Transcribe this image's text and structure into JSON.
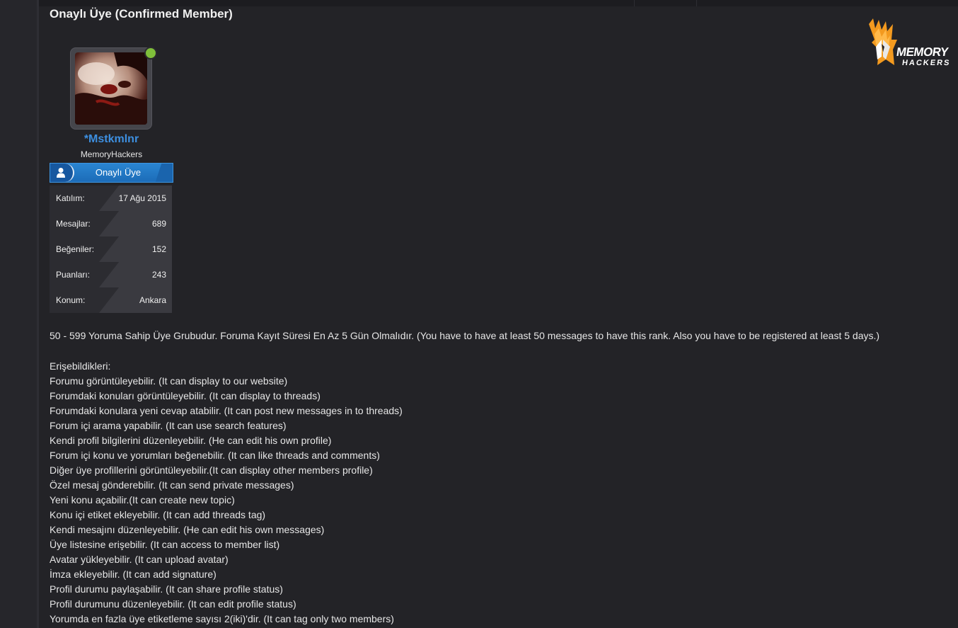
{
  "page": {
    "title": "Onaylı Üye (Confirmed Member)"
  },
  "logo": {
    "line1": "MEMORY",
    "line2": "HACKERS",
    "accent_color": "#f39a1f"
  },
  "profile": {
    "username": "*Mstkmlnr",
    "user_title": "MemoryHackers",
    "online": true,
    "rank_label": "Onaylı Üye",
    "rank_icon": "user-icon",
    "stats": [
      {
        "label": "Katılım:",
        "value": "17 Ağu 2015"
      },
      {
        "label": "Mesajlar:",
        "value": "689"
      },
      {
        "label": "Beğeniler:",
        "value": "152"
      },
      {
        "label": "Puanları:",
        "value": "243"
      },
      {
        "label": "Konum:",
        "value": "Ankara"
      }
    ]
  },
  "description": "50 - 599 Yoruma Sahip Üye Grubudur. Foruma Kayıt Süresi En Az 5 Gün Olmalıdır. (You have to have at least 50 messages to have this rank. Also you have to be registered at least 5 days.)",
  "permissions": {
    "heading": "Erişebildikleri:",
    "items": [
      "Forumu görüntüleyebilir. (It can display to our website)",
      "Forumdaki konuları görüntüleyebilir. (It can display to threads)",
      "Forumdaki konulara yeni cevap atabilir. (It can post new messages in to threads)",
      "Forum içi arama yapabilir. (It can use search features)",
      "Kendi profil bilgilerini düzenleyebilir. (He can edit his own profile)",
      "Forum içi konu ve yorumları beğenebilir. (It can like threads and comments)",
      "Diğer üye profillerini görüntüleyebilir.(It can display other members profile)",
      "Özel mesaj gönderebilir. (It can send private messages)",
      "Yeni konu açabilir.(It can create new topic)",
      "Konu içi etiket ekleyebilir. (It can add threads tag)",
      "Kendi mesajını düzenleyebilir. (He can edit his own messages)",
      "Üye listesine erişebilir. (It can access to member list)",
      "Avatar yükleyebilir. (It can upload avatar)",
      "İmza ekleyebilir. (It can add signature)",
      "Profil durumu paylaşabilir. (It can share profile status)",
      "Profil durumunu düzenleyebilir. (It can edit profile status)",
      "Yorumda en fazla üye etiketleme sayısı 2(iki)'dir. (It can tag only two members)"
    ]
  }
}
